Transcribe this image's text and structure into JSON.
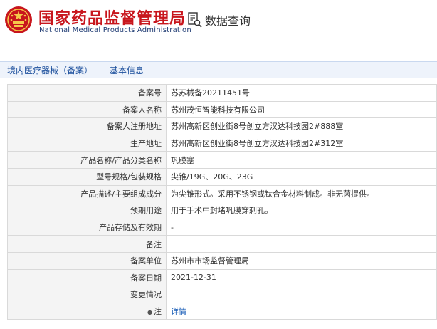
{
  "header": {
    "title_cn": "国家药品监督管理局",
    "title_en": "National Medical Products Administration",
    "query_label": "数据查询",
    "colors": {
      "brand_red": "#c8161d",
      "brand_blue": "#1f3b73",
      "link_blue": "#1c5fb8"
    }
  },
  "breadcrumb": "境内医疗器械（备案）——基本信息",
  "rows": [
    {
      "label": "备案号",
      "value": "苏苏械备20211451号"
    },
    {
      "label": "备案人名称",
      "value": "苏州茂恒智能科技有限公司"
    },
    {
      "label": "备案人注册地址",
      "value": "苏州高新区创业街8号创立方汉达科技园2#888室"
    },
    {
      "label": "生产地址",
      "value": "苏州高新区创业街8号创立方汉达科技园2#312室"
    },
    {
      "label": "产品名称/产品分类名称",
      "value": "巩膜塞"
    },
    {
      "label": "型号规格/包装规格",
      "value": "尖锥/19G、20G、23G"
    },
    {
      "label": "产品描述/主要组成成分",
      "value": "为尖锥形式。采用不锈钢或钛合金材料制成。非无菌提供。"
    },
    {
      "label": "预期用途",
      "value": "用于手术中封堵巩膜穿刺孔。"
    },
    {
      "label": "产品存储及有效期",
      "value": "-"
    },
    {
      "label": "备注",
      "value": ""
    },
    {
      "label": "备案单位",
      "value": "苏州市市场监督管理局"
    },
    {
      "label": "备案日期",
      "value": "2021-12-31"
    },
    {
      "label": "变更情况",
      "value": ""
    },
    {
      "label": "注",
      "value": "详情"
    }
  ]
}
